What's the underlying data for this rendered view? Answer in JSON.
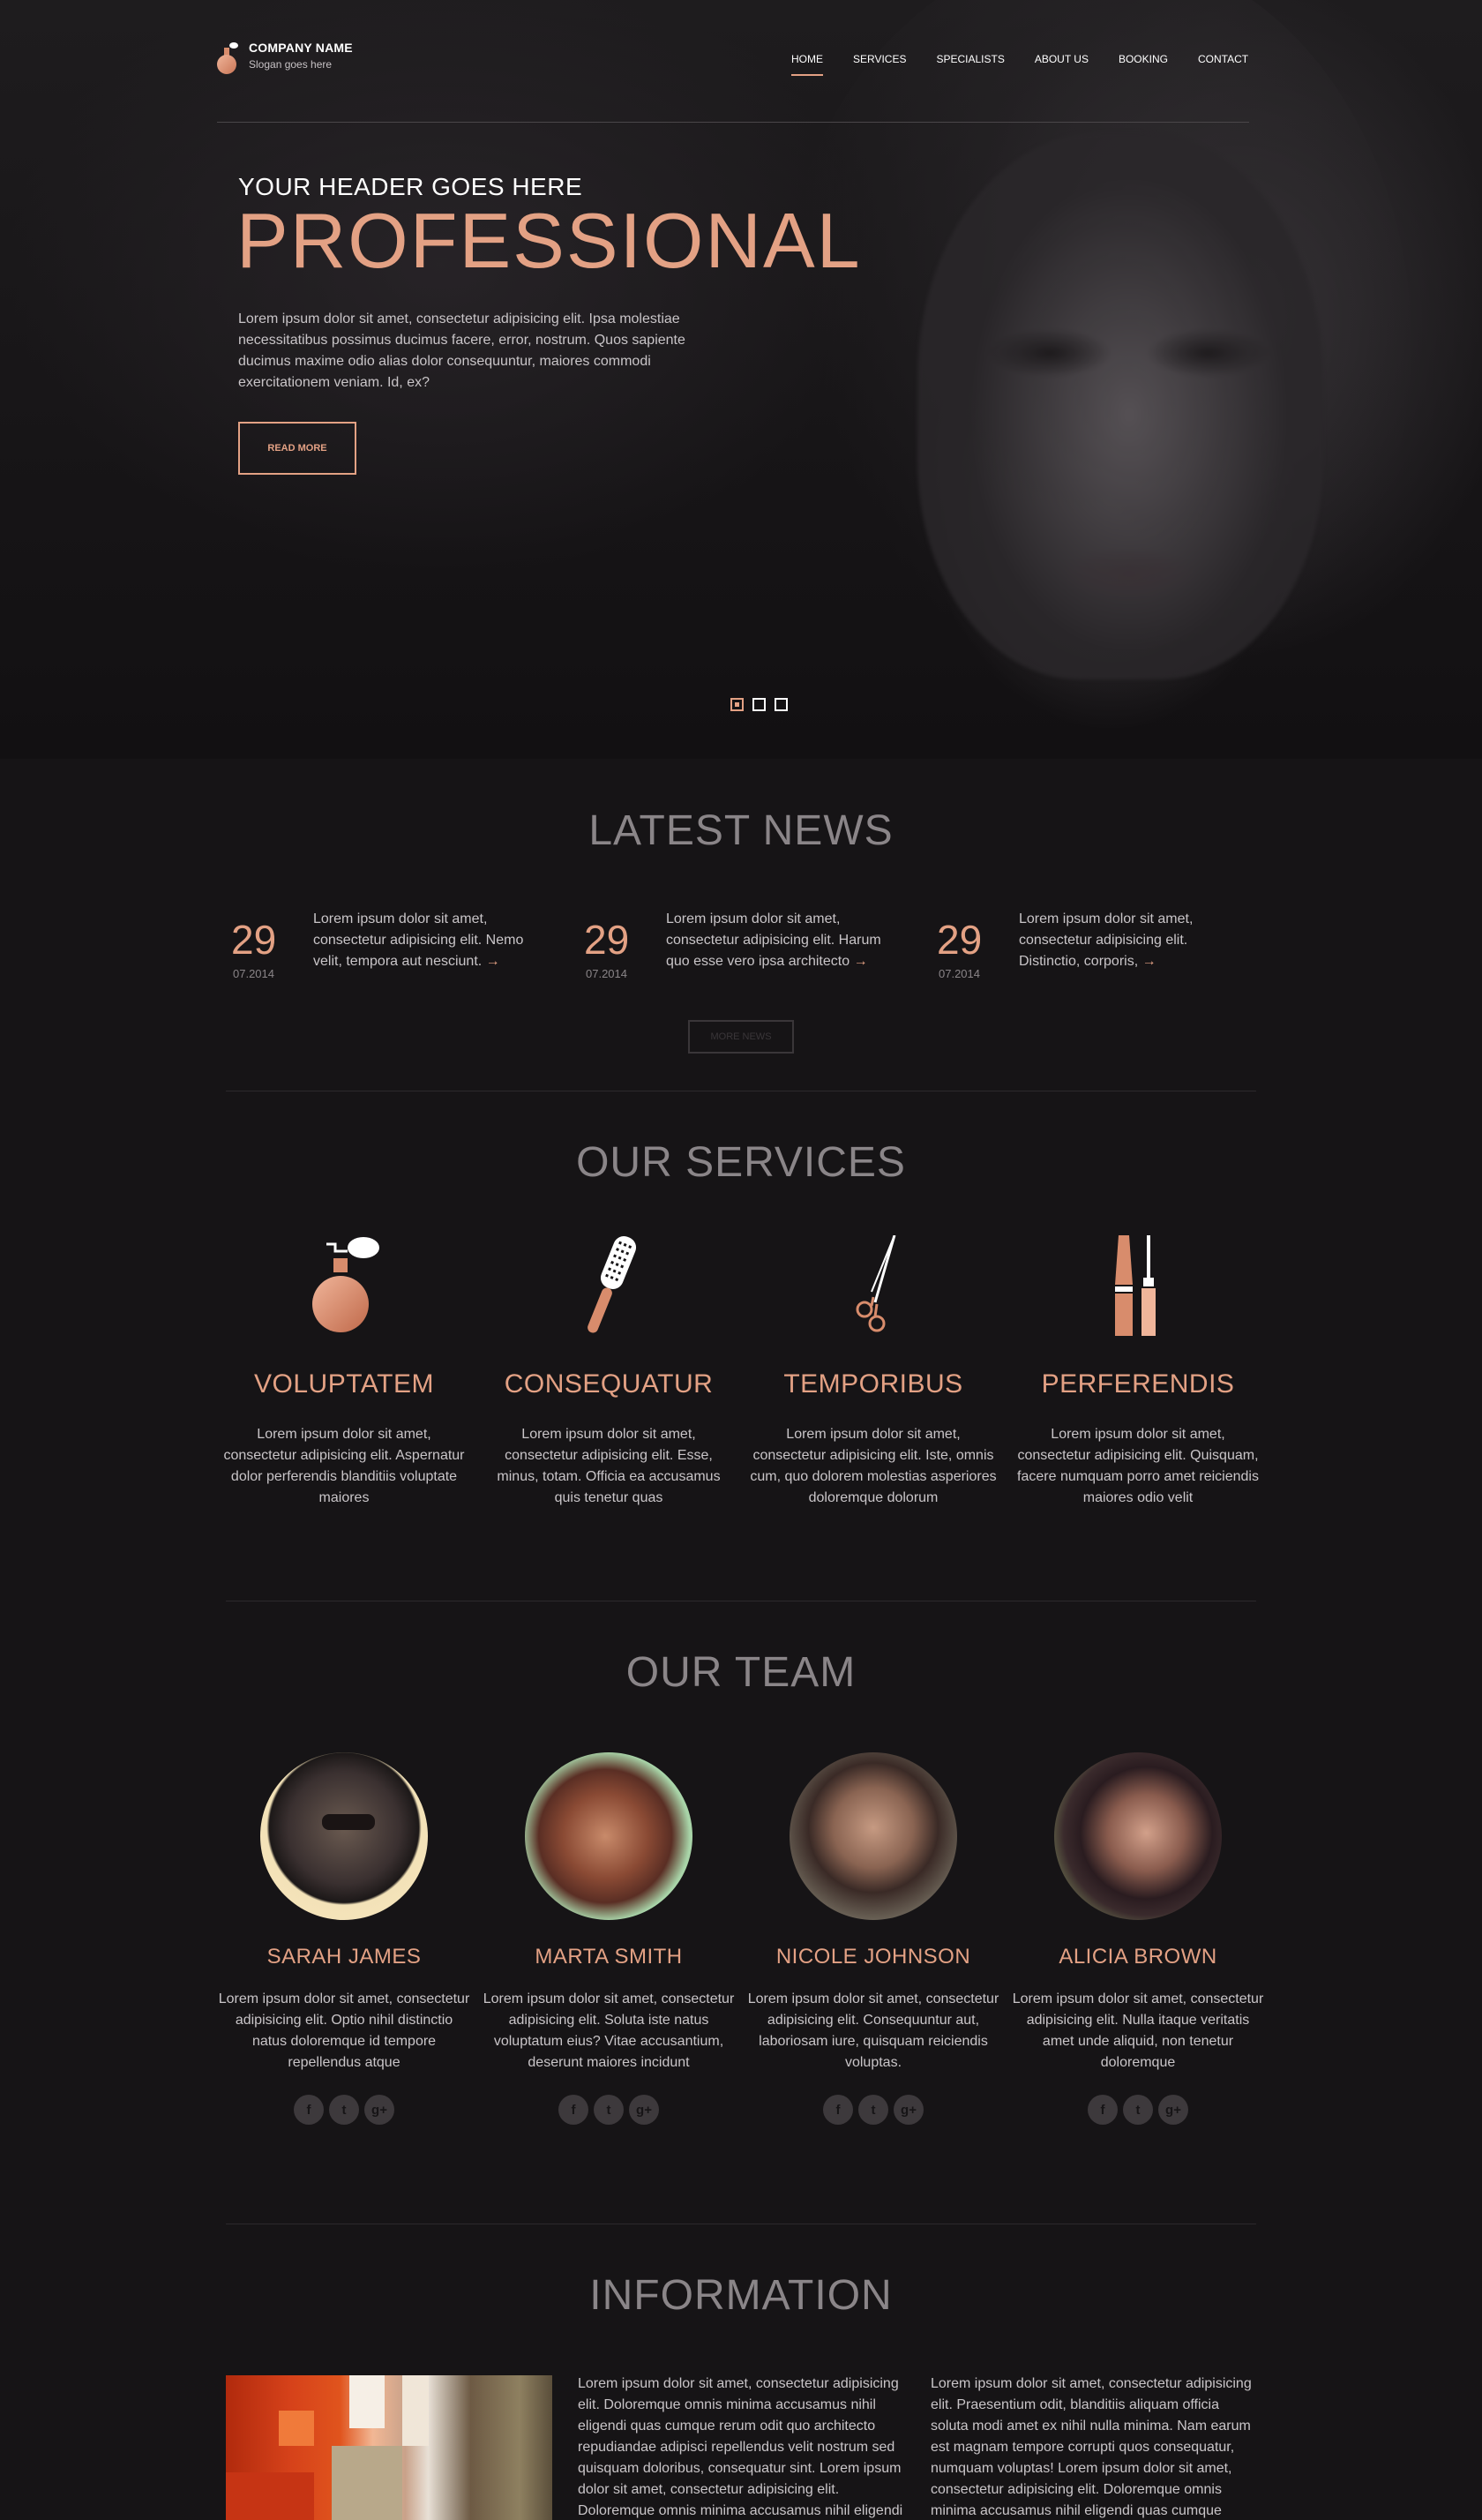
{
  "header": {
    "company_name": "COMPANY NAME",
    "slogan": "Slogan goes here",
    "nav": [
      {
        "label": "HOME",
        "active": true
      },
      {
        "label": "SERVICES",
        "active": false
      },
      {
        "label": "SPECIALISTS",
        "active": false
      },
      {
        "label": "ABOUT US",
        "active": false
      },
      {
        "label": "BOOKING",
        "active": false
      },
      {
        "label": "CONTACT",
        "active": false
      }
    ]
  },
  "hero": {
    "subtitle": "YOUR HEADER GOES HERE",
    "title": "PROFESSIONAL",
    "text": "Lorem ipsum dolor sit amet, consectetur adipisicing elit. Ipsa molestiae necessitatibus possimus ducimus facere, error, nostrum. Quos sapiente ducimus maxime odio alias dolor consequuntur, maiores commodi exercitationem veniam. Id, ex?",
    "button": "READ MORE",
    "slides": 3,
    "active_slide": 1
  },
  "news": {
    "title": "LATEST NEWS",
    "items": [
      {
        "day": "29",
        "date": "07.2014",
        "text": "Lorem ipsum dolor sit amet, consectetur adipisicing elit. Nemo velit, tempora aut nesciunt.",
        "arrow": "→"
      },
      {
        "day": "29",
        "date": "07.2014",
        "text": "Lorem ipsum dolor sit amet, consectetur adipisicing elit. Harum quo esse vero ipsa architecto",
        "arrow": "→"
      },
      {
        "day": "29",
        "date": "07.2014",
        "text": "Lorem ipsum dolor sit amet, consectetur adipisicing elit. Distinctio, corporis,",
        "arrow": "→"
      }
    ],
    "more_button": "MORE NEWS"
  },
  "services": {
    "title": "OUR SERVICES",
    "items": [
      {
        "icon": "perfume-icon",
        "name": "VOLUPTATEM",
        "text": "Lorem ipsum dolor sit amet, consectetur adipisicing elit. Aspernatur dolor perferendis blanditiis voluptate maiores"
      },
      {
        "icon": "hairbrush-icon",
        "name": "CONSEQUATUR",
        "text": "Lorem ipsum dolor sit amet, consectetur adipisicing elit. Esse, minus, totam. Officia ea accusamus quis tenetur quas"
      },
      {
        "icon": "scissors-icon",
        "name": "TEMPORIBUS",
        "text": "Lorem ipsum dolor sit amet, consectetur adipisicing elit. Iste, omnis cum, quo dolorem molestias asperiores doloremque dolorum"
      },
      {
        "icon": "makeup-icon",
        "name": "PERFERENDIS",
        "text": "Lorem ipsum dolor sit amet, consectetur adipisicing elit. Quisquam, facere numquam porro amet reiciendis maiores odio velit"
      }
    ]
  },
  "team": {
    "title": "OUR TEAM",
    "members": [
      {
        "name": "SARAH JAMES",
        "text": "Lorem ipsum dolor sit amet, consectetur adipisicing elit. Optio nihil distinctio natus doloremque id tempore repellendus atque"
      },
      {
        "name": "MARTA SMITH",
        "text": "Lorem ipsum dolor sit amet, consectetur adipisicing elit. Soluta iste natus voluptatum eius? Vitae accusantium, deserunt maiores incidunt"
      },
      {
        "name": "NICOLE JOHNSON",
        "text": "Lorem ipsum dolor sit amet, consectetur adipisicing elit. Consequuntur aut, laboriosam iure, quisquam reiciendis voluptas."
      },
      {
        "name": "ALICIA BROWN",
        "text": "Lorem ipsum dolor sit amet, consectetur adipisicing elit. Nulla itaque veritatis amet unde aliquid, non tenetur doloremque"
      }
    ],
    "social_glyphs": {
      "facebook": "f",
      "twitter": "t",
      "google_plus": "g+"
    }
  },
  "information": {
    "title": "INFORMATION",
    "col1": "Lorem ipsum dolor sit amet, consectetur adipisicing elit. Doloremque omnis minima accusamus nihil eligendi quas cumque rerum odit quo architecto repudiandae adipisci repellendus velit nostrum sed quisquam doloribus, consequatur sint. Lorem ipsum dolor sit amet, consectetur adipisicing elit. Doloremque omnis minima accusamus nihil eligendi",
    "col2": "Lorem ipsum dolor sit amet, consectetur adipisicing elit. Praesentium odit, blanditiis aliquam officia soluta modi amet ex nihil nulla minima. Nam earum est magnam tempore corrupti quos consequatur, numquam voluptas! Lorem ipsum dolor sit amet, consectetur adipisicing elit. Doloremque omnis minima accusamus nihil eligendi quas cumque"
  },
  "colors": {
    "accent": "#e3a184",
    "background": "#161416",
    "heading_gray": "#8a8588",
    "text": "#c9c5c8"
  }
}
